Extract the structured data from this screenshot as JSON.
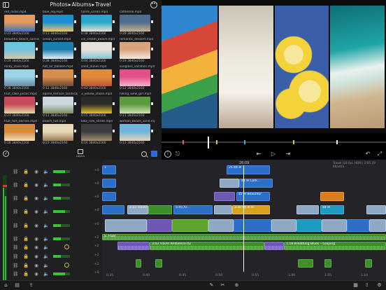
{
  "browser": {
    "breadcrumb": [
      "Photos",
      "Albums",
      "Travel"
    ],
    "separator": "▸",
    "done_glyph": "✓",
    "layers_label": "Layers",
    "items": [
      {
        "file": "red_rocks.mp4",
        "meta": "0:23  3840x2160",
        "thumb": [
          "#e39a5c",
          "#3f75b8"
        ]
      },
      {
        "file": "blue_sky.mp4",
        "meta": "0:13  3840x2160",
        "thumb": [
          "#1b8fd0",
          "#f1c26b"
        ]
      },
      {
        "file": "fjords_ocean.mp4",
        "meta": "0:38  3840x2160",
        "thumb": [
          "#2aa6c9",
          "#e8e2cf"
        ]
      },
      {
        "file": "cathedral.mp4",
        "meta": "0:29  3840x2160",
        "thumb": [
          "#4e6d8f",
          "#c6b28c"
        ]
      },
      {
        "file": "beautiful_beach_sunrise.mp4",
        "meta": "0:19  3840x2160",
        "thumb": [
          "#6fc3e0",
          "#d6c9a8"
        ]
      },
      {
        "file": "ocean_sunset.mp4",
        "meta": "0:38  3840x2160",
        "thumb": [
          "#1a7fb0",
          "#e8f0f4"
        ]
      },
      {
        "file": "ice_cream_beach.mp4",
        "meta": "0:44  3840x2160",
        "thumb": [
          "#e6e1d8",
          "#80c4d7"
        ]
      },
      {
        "file": "romantic_dessert.mp4",
        "meta": "0:19  3840x2160",
        "thumb": [
          "#d8a37e",
          "#f3ebe3"
        ]
      },
      {
        "file": "rocky_cove.mp4",
        "meta": "0:38  3840x2160",
        "thumb": [
          "#9cd3e8",
          "#6a8aa0"
        ]
      },
      {
        "file": "hot_air_balloon.mp4",
        "meta": "0:12  3840x2160",
        "thumb": [
          "#d98e4c",
          "#6b4a36"
        ]
      },
      {
        "file": "sand_dunes.mp4",
        "meta": "0:43  3840x2160",
        "thumb": [
          "#e08b3a",
          "#b4583a"
        ]
      },
      {
        "file": "sunglass_vacation.mp4",
        "meta": "0:12  3840x2160",
        "thumb": [
          "#e34f8a",
          "#f0b3c8"
        ]
      },
      {
        "file": "fruit_cake_picnic.mp4",
        "meta": "0:23  3840x2160",
        "thumb": [
          "#c74b5a",
          "#e6d6a8"
        ]
      },
      {
        "file": "alpine_terrace_landscape.mp4",
        "meta": "0:11  3840x2160",
        "thumb": [
          "#ccd6de",
          "#7a8c5e"
        ]
      },
      {
        "file": "3_yellow_shoes.mp4",
        "meta": "0:15  3840x2160",
        "thumb": [
          "#2a2a2a",
          "#e2c52a"
        ]
      },
      {
        "file": "hiking_view_girl.mp4",
        "meta": "0:11  3840x2160",
        "thumb": [
          "#5d9b3d",
          "#cfe0b8"
        ]
      },
      {
        "file": "fruit_tart_berries.mp4",
        "meta": "0:18  3840x2160",
        "thumb": [
          "#d68a3c",
          "#f2dfb6"
        ]
      },
      {
        "file": "beach_hat.mp4",
        "meta": "0:23  3840x2160",
        "thumb": [
          "#e7d9b7",
          "#9c7b52"
        ]
      },
      {
        "file": "bike_ride_street.mp4",
        "meta": "0:16  3840x2160",
        "thumb": [
          "#3c3c40",
          "#a38e6a"
        ]
      },
      {
        "file": "woman_beach_sand.mp4",
        "meta": "0:13  3840x2160",
        "thumb": [
          "#6fb5db",
          "#e7d3b3"
        ]
      }
    ]
  },
  "viewer": {
    "panels": [
      {
        "name": "burano-houses",
        "colors": [
          "#2e86d1",
          "#d6473a",
          "#f2b23c",
          "#3aa14a"
        ]
      },
      {
        "name": "woman-white-dress",
        "colors": [
          "#d8d2c4",
          "#e9e2d6",
          "#b4a48e",
          "#f2eee8"
        ]
      },
      {
        "name": "lemon-slices",
        "colors": [
          "#f3d23a",
          "#3a5ea8",
          "#f7e79a",
          "#e8e8e8"
        ]
      },
      {
        "name": "ocean-waves",
        "colors": [
          "#0e6f77",
          "#1fa5a6",
          "#e9f1ee",
          "#cfb58f"
        ]
      }
    ],
    "scrub_colors": [
      "#e25c5c",
      "#e2c52a",
      "#3bb3d6",
      "#e2c52a",
      "#f0f0f0"
    ]
  },
  "timeline": {
    "timecode": "26:09",
    "info": "Travel (24 fps, HDR): 2:05:29  4k/ultra",
    "track_db": [
      "+0",
      "+0",
      "+0",
      "+0",
      "+0",
      "+2",
      "+2",
      "+2",
      "+2",
      "+0"
    ],
    "time_marks": [
      "0:35",
      "0:40",
      "0:45",
      "0:50",
      "0:55",
      "1:00",
      "1:05",
      "1:10"
    ],
    "clips": {
      "r1a": "2S  🎞 ✉",
      "r1b": "1",
      "r2a": "🎞 ✉  Cork…",
      "r3a": "🎞 ✉  Beautiful",
      "r3b": "🎞 ✉",
      "r4a": "2:15  Travel",
      "r4b": "5:45  Ar…",
      "r4c": "3:30  🎞 ✉  ✉",
      "r4d": "🎞 ✉",
      "audio1": "S. Fluer",
      "audio2": "3:43  Travel Ambience.02",
      "audio3": "1:18  Breathing Blues – Looping"
    }
  }
}
